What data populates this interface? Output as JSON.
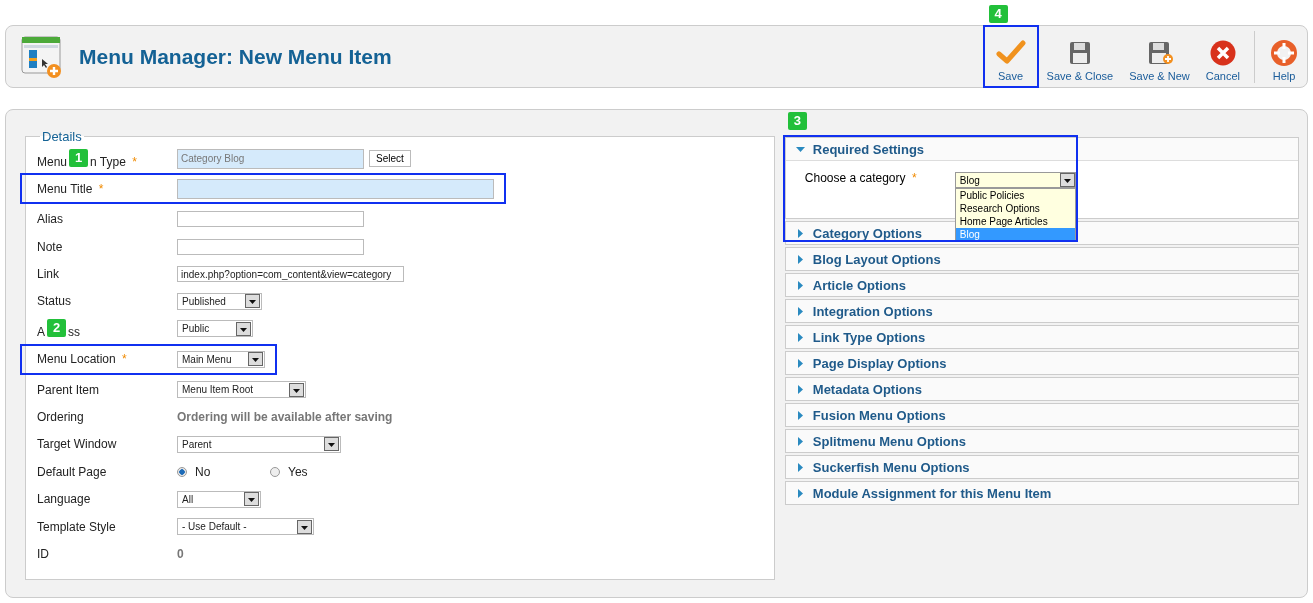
{
  "header": {
    "title": "Menu Manager: New Menu Item"
  },
  "toolbar": [
    {
      "kind": "save",
      "label": "Save",
      "highlighted": true,
      "badge": "4"
    },
    {
      "kind": "save-close",
      "label": "Save & Close",
      "highlighted": false
    },
    {
      "kind": "save-new",
      "label": "Save & New",
      "highlighted": false
    },
    {
      "kind": "cancel",
      "label": "Cancel",
      "highlighted": false
    },
    {
      "kind": "help",
      "label": "Help",
      "highlighted": false
    }
  ],
  "details": {
    "legend": "Details",
    "rows": [
      {
        "kind": "button-field",
        "label_parts": [
          "Menu",
          "n Type"
        ],
        "badge": "1",
        "required_mark": "*",
        "value": "Category Blog",
        "readonly": true,
        "button": "Select",
        "highlighted": false
      },
      {
        "kind": "text",
        "label": "Menu Title",
        "required_mark": "*",
        "focused": true,
        "highlighted": true
      },
      {
        "kind": "text",
        "label": "Alias",
        "focused": false,
        "highlighted": false
      },
      {
        "kind": "text",
        "label": "Note",
        "focused": false,
        "highlighted": false
      },
      {
        "kind": "text",
        "label": "Link",
        "value": "index.php?option=com_content&view=category",
        "focused": false,
        "highlighted": false
      },
      {
        "kind": "select",
        "label": "Status",
        "value": "Published",
        "highlighted": false
      },
      {
        "kind": "select",
        "label_parts": [
          "A",
          "ss"
        ],
        "badge": "2",
        "value": "Public",
        "highlighted": false
      },
      {
        "kind": "select",
        "label": "Menu Location",
        "required_mark": "*",
        "value": "Main Menu",
        "highlighted": true
      },
      {
        "kind": "select",
        "label": "Parent Item",
        "value": "Menu Item Root",
        "highlighted": false
      },
      {
        "kind": "static",
        "label": "Ordering",
        "value": "Ordering will be available after saving",
        "highlighted": false
      },
      {
        "kind": "select",
        "label": "Target Window",
        "value": "Parent",
        "highlighted": false
      },
      {
        "kind": "radio",
        "label": "Default Page",
        "options": [
          {
            "label": "No",
            "selected": true
          },
          {
            "label": "Yes",
            "selected": false
          }
        ],
        "highlighted": false
      },
      {
        "kind": "select",
        "label": "Language",
        "value": "All",
        "highlighted": false
      },
      {
        "kind": "select",
        "label": "Template Style",
        "value": "- Use Default -",
        "highlighted": false
      },
      {
        "kind": "static",
        "label": "ID",
        "value": "0",
        "highlighted": false
      }
    ]
  },
  "panels": [
    {
      "title": "Required Settings",
      "expanded": true,
      "highlighted": true,
      "badge": "3",
      "field": {
        "label": "Choose a category",
        "required_mark": "*",
        "value": "Blog",
        "open": true,
        "options": [
          {
            "label": "Public Policies",
            "selected": false
          },
          {
            "label": "Research Options",
            "selected": false
          },
          {
            "label": "Home Page Articles",
            "selected": false
          },
          {
            "label": "Blog",
            "selected": true
          }
        ]
      }
    },
    {
      "title": "Category Options",
      "expanded": false
    },
    {
      "title": "Blog Layout Options",
      "expanded": false
    },
    {
      "title": "Article Options",
      "expanded": false
    },
    {
      "title": "Integration Options",
      "expanded": false
    },
    {
      "title": "Link Type Options",
      "expanded": false
    },
    {
      "title": "Page Display Options",
      "expanded": false
    },
    {
      "title": "Metadata Options",
      "expanded": false
    },
    {
      "title": "Fusion Menu Options",
      "expanded": false
    },
    {
      "title": "Splitmenu Menu Options",
      "expanded": false
    },
    {
      "title": "Suckerfish Menu Options",
      "expanded": false
    },
    {
      "title": "Module Assignment for this Menu Item",
      "expanded": false
    }
  ]
}
